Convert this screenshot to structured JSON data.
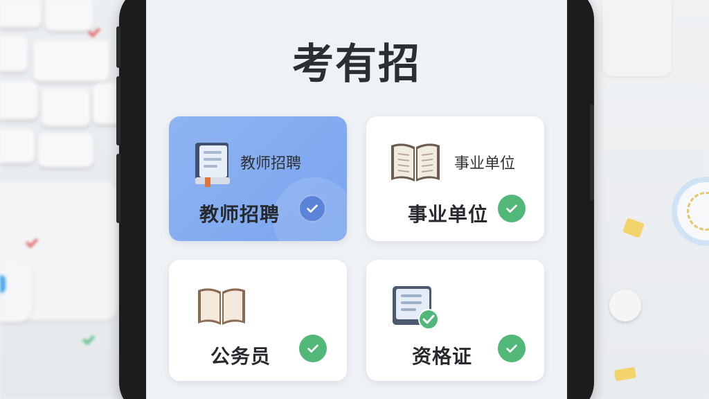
{
  "app": {
    "title": "考有招"
  },
  "cards": [
    {
      "label": "教师招聘",
      "sublabel": "教师招聘",
      "icon": "book-icon",
      "selected": true
    },
    {
      "label": "事业单位",
      "sublabel": "事业单位",
      "icon": "open-book-icon",
      "selected": false
    },
    {
      "label": "公务员",
      "icon": "open-book-icon",
      "selected": false
    },
    {
      "label": "资格证",
      "icon": "certificate-document-icon",
      "selected": false
    }
  ],
  "colors": {
    "selected_card": "#7aa4ee",
    "check_green": "#52b879",
    "check_blue": "#5b83d6",
    "title_text": "#2b2f33"
  }
}
